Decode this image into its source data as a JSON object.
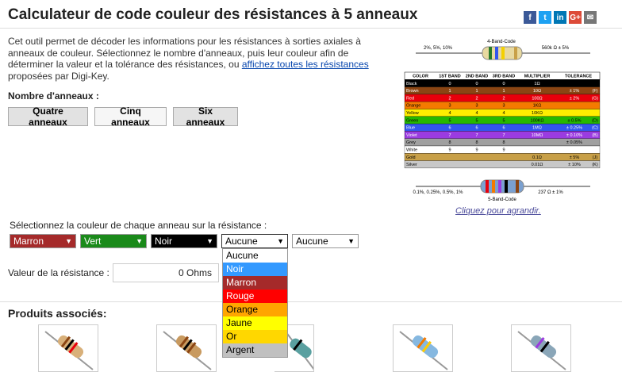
{
  "page": {
    "title": "Calculateur de code couleur des résistances à 5 anneaux",
    "intro_1": "Cet outil permet de décoder les informations pour les résistances à sorties axiales à anneaux de couleur. Sélectionnez le nombre d'anneaux, puis leur couleur afin de déterminer la valeur et la tolérance des résistances, ou ",
    "intro_link": "affichez toutes les résistances",
    "intro_2": " proposées par Digi-Key."
  },
  "social": [
    "f",
    "t",
    "in",
    "G+",
    "✉"
  ],
  "bands": {
    "label": "Nombre d'anneaux :",
    "buttons": [
      "Quatre anneaux",
      "Cinq anneaux",
      "Six anneaux"
    ]
  },
  "chart": {
    "top_caption": "4-Band-Code",
    "top_left": "2%, 5%, 10%",
    "top_right": "560k Ω   ± 5%",
    "bottom_caption": "5-Band-Code",
    "bottom_left": "0.1%, 0.25%, 0.5%, 1%",
    "bottom_right": "237 Ω   ± 1%",
    "headers": [
      "COLOR",
      "1ST BAND",
      "2ND BAND",
      "3RD BAND",
      "MULTIPLIER",
      "TOLERANCE"
    ],
    "rows": [
      {
        "name": "Black",
        "d1": "0",
        "d2": "0",
        "d3": "0",
        "mult": "1Ω",
        "tol": "",
        "code": "",
        "color": "#000000",
        "text": "#ffffff"
      },
      {
        "name": "Brown",
        "d1": "1",
        "d2": "1",
        "d3": "1",
        "mult": "10Ω",
        "tol": "± 1%",
        "code": "(F)",
        "color": "#8b4513",
        "text": "#ffffff"
      },
      {
        "name": "Red",
        "d1": "2",
        "d2": "2",
        "d3": "2",
        "mult": "100Ω",
        "tol": "± 2%",
        "code": "(G)",
        "color": "#e8000b",
        "text": "#ffffff"
      },
      {
        "name": "Orange",
        "d1": "3",
        "d2": "3",
        "d3": "3",
        "mult": "1KΩ",
        "tol": "",
        "code": "",
        "color": "#f47a00",
        "text": "#000000"
      },
      {
        "name": "Yellow",
        "d1": "4",
        "d2": "4",
        "d3": "4",
        "mult": "10KΩ",
        "tol": "",
        "code": "",
        "color": "#ffed00",
        "text": "#000000"
      },
      {
        "name": "Green",
        "d1": "5",
        "d2": "5",
        "d3": "5",
        "mult": "100KΩ",
        "tol": "± 0.5%",
        "code": "(D)",
        "color": "#27b800",
        "text": "#000000"
      },
      {
        "name": "Blue",
        "d1": "6",
        "d2": "6",
        "d3": "6",
        "mult": "1MΩ",
        "tol": "± 0.25%",
        "code": "(C)",
        "color": "#3355ee",
        "text": "#ffffff"
      },
      {
        "name": "Violet",
        "d1": "7",
        "d2": "7",
        "d3": "7",
        "mult": "10MΩ",
        "tol": "± 0.10%",
        "code": "(B)",
        "color": "#9b3be0",
        "text": "#ffffff"
      },
      {
        "name": "Grey",
        "d1": "8",
        "d2": "8",
        "d3": "8",
        "mult": "",
        "tol": "± 0.05%",
        "code": "",
        "color": "#a0a0a0",
        "text": "#000000"
      },
      {
        "name": "White",
        "d1": "9",
        "d2": "9",
        "d3": "9",
        "mult": "",
        "tol": "",
        "code": "",
        "color": "#ffffff",
        "text": "#000000"
      },
      {
        "name": "Gold",
        "d1": "",
        "d2": "",
        "d3": "",
        "mult": "0.1Ω",
        "tol": "± 5%",
        "code": "(J)",
        "color": "#c8a048",
        "text": "#000000"
      },
      {
        "name": "Silver",
        "d1": "",
        "d2": "",
        "d3": "",
        "mult": "0.01Ω",
        "tol": "± 10%",
        "code": "(K)",
        "color": "#c8c8c8",
        "text": "#000000"
      }
    ],
    "enlarge": "Cliquez pour agrandir."
  },
  "selectors": {
    "label": "Sélectionnez la couleur de chaque anneau sur la résistance :",
    "items": [
      {
        "value": "Marron",
        "bg": "#a52a2a",
        "fg": "#ffffff"
      },
      {
        "value": "Vert",
        "bg": "#1a8a1a",
        "fg": "#ffffff"
      },
      {
        "value": "Noir",
        "bg": "#000000",
        "fg": "#ffffff"
      },
      {
        "value": "Aucune",
        "bg": "#ffffff",
        "fg": "#000000"
      },
      {
        "value": "Aucune",
        "bg": "#ffffff",
        "fg": "#000000"
      }
    ]
  },
  "dropdown": {
    "options": [
      {
        "label": "Aucune",
        "bg": "#ffffff",
        "fg": "#000000"
      },
      {
        "label": "Noir",
        "bg": "#3399ff",
        "fg": "#ffffff"
      },
      {
        "label": "Marron",
        "bg": "#a52a2a",
        "fg": "#ffffff"
      },
      {
        "label": "Rouge",
        "bg": "#ff0000",
        "fg": "#ffffff"
      },
      {
        "label": "Orange",
        "bg": "#ffa500",
        "fg": "#000000"
      },
      {
        "label": "Jaune",
        "bg": "#ffff00",
        "fg": "#000000"
      },
      {
        "label": "Or",
        "bg": "#ffd700",
        "fg": "#000000"
      },
      {
        "label": "Argent",
        "bg": "#c0c0c0",
        "fg": "#000000"
      }
    ]
  },
  "value": {
    "label": "Valeur de la résistance :",
    "value": "0 Ohms"
  },
  "products": {
    "title": "Produits associés:"
  }
}
